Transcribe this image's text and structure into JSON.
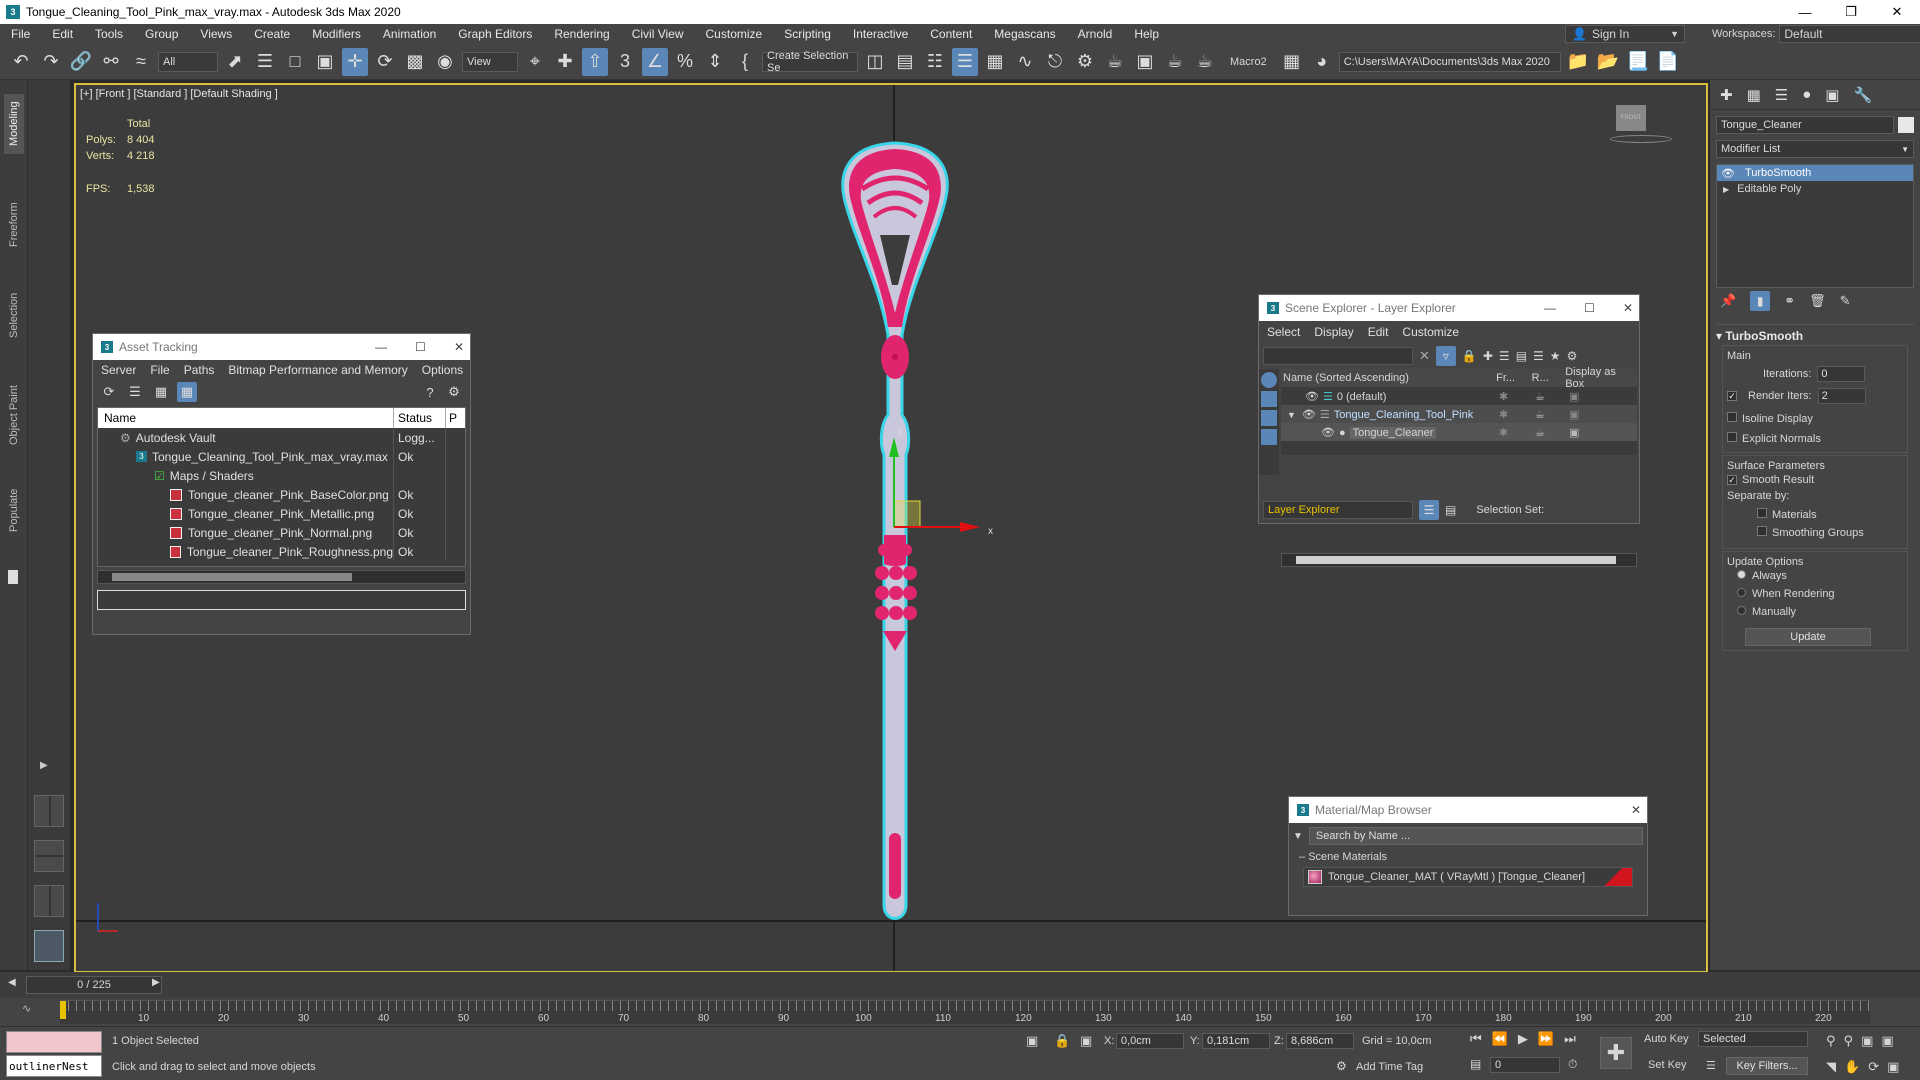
{
  "window": {
    "title": "Tongue_Cleaning_Tool_Pink_max_vray.max - Autodesk 3ds Max 2020",
    "app_icon": "3"
  },
  "menu": [
    "File",
    "Edit",
    "Tools",
    "Group",
    "Views",
    "Create",
    "Modifiers",
    "Animation",
    "Graph Editors",
    "Rendering",
    "Civil View",
    "Customize",
    "Scripting",
    "Interactive",
    "Content",
    "Megascans",
    "Arnold",
    "Help"
  ],
  "account": {
    "signin_label": "Sign In",
    "workspaces_label": "Workspaces:",
    "workspace_value": "Default"
  },
  "toolbar": {
    "filter_value": "All",
    "view_value": "View",
    "selection_set_value": "Create Selection Se",
    "macro_label": "Macro2",
    "path_value": "C:\\Users\\MAYA\\Documents\\3ds Max 2020"
  },
  "ribbon_tabs": [
    "Modeling",
    "Freeform",
    "Selection",
    "Object Paint",
    "Populate"
  ],
  "viewport": {
    "label": "[+] [Front ] [Standard ] [Default Shading ]",
    "stats_header": "Total",
    "polys_label": "Polys:",
    "polys_value": "8 404",
    "verts_label": "Verts:",
    "verts_value": "4 218",
    "fps_label": "FPS:",
    "fps_value": "1,538",
    "gizmo_x": "x",
    "gizmo_y": "y",
    "viewcube_label": "FRONT"
  },
  "asset_tracking": {
    "title": "Asset Tracking",
    "menu": [
      "Server",
      "File",
      "Paths",
      "Bitmap Performance and Memory",
      "Options"
    ],
    "col_name": "Name",
    "col_status": "Status",
    "col_extra": "P",
    "rows": [
      {
        "name": "Autodesk Vault",
        "status": "Logg...",
        "indent": 0
      },
      {
        "name": "Tongue_Cleaning_Tool_Pink_max_vray.max",
        "status": "Ok",
        "indent": 1
      },
      {
        "name": "Maps / Shaders",
        "status": "",
        "indent": 2
      },
      {
        "name": "Tongue_cleaner_Pink_BaseColor.png",
        "status": "Ok",
        "indent": 3
      },
      {
        "name": "Tongue_cleaner_Pink_Metallic.png",
        "status": "Ok",
        "indent": 3
      },
      {
        "name": "Tongue_cleaner_Pink_Normal.png",
        "status": "Ok",
        "indent": 3
      },
      {
        "name": "Tongue_cleaner_Pink_Roughness.png",
        "status": "Ok",
        "indent": 3
      }
    ]
  },
  "scene_explorer": {
    "title": "Scene Explorer - Layer Explorer",
    "menu": [
      "Select",
      "Display",
      "Edit",
      "Customize"
    ],
    "col_name": "Name (Sorted Ascending)",
    "col_fr": "Fr...",
    "col_r": "R...",
    "col_box": "Display as Box",
    "rows": [
      {
        "name": "0 (default)",
        "indent": 0
      },
      {
        "name": "Tongue_Cleaning_Tool_Pink",
        "indent": 0
      },
      {
        "name": "Tongue_Cleaner",
        "indent": 1
      }
    ],
    "footer_dropdown": "Layer Explorer",
    "selection_set_label": "Selection Set:"
  },
  "material_browser": {
    "title": "Material/Map Browser",
    "search_placeholder": "Search by Name ...",
    "group_label": "Scene Materials",
    "material_item": "Tongue_Cleaner_MAT  ( VRayMtl )  [Tongue_Cleaner]"
  },
  "command_panel": {
    "object_name": "Tongue_Cleaner",
    "modifier_list_label": "Modifier List",
    "stack": [
      "TurboSmooth",
      "Editable Poly"
    ],
    "rollout_title": "TurboSmooth",
    "main_label": "Main",
    "iterations_label": "Iterations:",
    "iterations_value": "0",
    "render_iters_label": "Render Iters:",
    "render_iters_value": "2",
    "isoline_label": "Isoline Display",
    "explicit_normals_label": "Explicit Normals",
    "surface_params_label": "Surface Parameters",
    "smooth_result_label": "Smooth Result",
    "separate_by_label": "Separate by:",
    "materials_label": "Materials",
    "smoothing_groups_label": "Smoothing Groups",
    "update_options_label": "Update Options",
    "always_label": "Always",
    "when_rendering_label": "When Rendering",
    "manually_label": "Manually",
    "update_button": "Update"
  },
  "timeline": {
    "frame_label": "0 / 225",
    "ticks": [
      "10",
      "20",
      "30",
      "40",
      "50",
      "60",
      "70",
      "80",
      "90",
      "100",
      "110",
      "120",
      "130",
      "140",
      "150",
      "160",
      "170",
      "180",
      "190",
      "200",
      "210",
      "220"
    ]
  },
  "status": {
    "script_listener": "outlinerNest",
    "selected_text": "1 Object Selected",
    "prompt_text": "Click and drag to select and move objects",
    "x_label": "X:",
    "x_value": "0,0cm",
    "y_label": "Y:",
    "y_value": "0,181cm",
    "z_label": "Z:",
    "z_value": "8,686cm",
    "grid_label": "Grid = 10,0cm",
    "add_time_tag": "Add Time Tag",
    "auto_key": "Auto Key",
    "set_key": "Set Key",
    "selected_dd": "Selected",
    "key_filters": "Key Filters...",
    "frame_value": "0"
  },
  "colors": {
    "accent": "#5a86b8",
    "viewport_border": "#d9c03a",
    "model_pink": "#e0256e",
    "model_body": "#c9c7dc",
    "selection_outline": "#38d6e8"
  }
}
